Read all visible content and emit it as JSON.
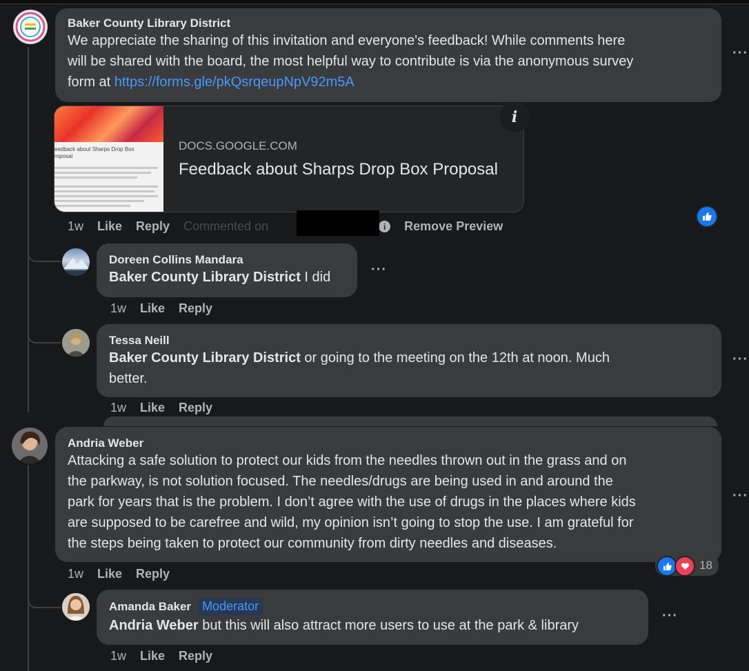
{
  "comments": [
    {
      "author": "Baker County Library District",
      "text_lines": [
        "We appreciate the sharing of this invitation and everyone's feedback! While comments here",
        "will be shared with the board, the most helpful way to contribute is via the anonymous survey"
      ],
      "text_line3_prefix": "form at ",
      "link": "https://forms.gle/pkQsrqeupNpV92m5A",
      "preview": {
        "domain": "DOCS.GOOGLE.COM",
        "title": "Feedback about Sharps Drop Box Proposal",
        "thumb_heading": "eedback about Sharps Drop Box\nroposal",
        "info_icon": "i"
      },
      "time": "1w",
      "like": "Like",
      "reply": "Reply",
      "commented_on": "Commented on",
      "remove_preview": "Remove Preview",
      "replies": [
        {
          "author": "Doreen Collins Mandara",
          "mention": "Baker County Library District",
          "text": " I did",
          "time": "1w",
          "like": "Like",
          "reply": "Reply"
        },
        {
          "author": "Tessa Neill",
          "mention": "Baker County Library District",
          "text": " or going to the meeting on the 12th at noon. Much",
          "text2": "better.",
          "time": "1w",
          "like": "Like",
          "reply": "Reply"
        }
      ]
    },
    {
      "author": "Andria Weber",
      "text_lines": [
        "Attacking a safe solution to protect our kids from the needles thrown out in the grass and on",
        "the parkway, is not solution focused. The needles/drugs are being used in and around the",
        "park for years that is the problem. I don’t agree with the use of drugs in the places where kids",
        "are supposed to be carefree and wild, my opinion isn’t going to stop the use. I am grateful for",
        "the steps being taken to protect our community from dirty needles and diseases."
      ],
      "time": "1w",
      "like": "Like",
      "reply": "Reply",
      "reaction_count": "18",
      "replies": [
        {
          "author": "Amanda Baker",
          "badge": "Moderator",
          "mention": "Andria Weber",
          "text": " but this will also attract more users to use at the park & library",
          "time": "1w",
          "like": "Like",
          "reply": "Reply"
        }
      ]
    }
  ],
  "more_label": "···",
  "colors": {
    "bubble": "#3a3b3c",
    "link": "#4599ff",
    "like": "#1877f2",
    "love": "#f33e58",
    "background": "#18191a"
  }
}
